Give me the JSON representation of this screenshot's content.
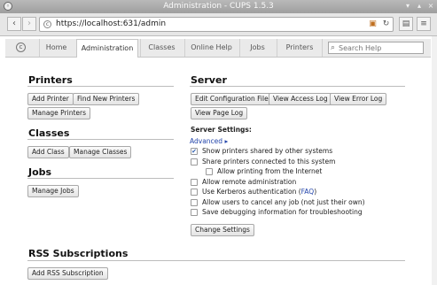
{
  "window": {
    "title": "Administration - CUPS 1.5.3"
  },
  "browser": {
    "url": "https://localhost:631/admin",
    "back_glyph": "‹",
    "forward_glyph": "›",
    "menu_glyph": "≡"
  },
  "tabs": [
    {
      "label": "Home",
      "active": false
    },
    {
      "label": "Administration",
      "active": true
    },
    {
      "label": "Classes",
      "active": false
    },
    {
      "label": "Online Help",
      "active": false
    },
    {
      "label": "Jobs",
      "active": false
    },
    {
      "label": "Printers",
      "active": false
    }
  ],
  "search": {
    "placeholder": "Search Help"
  },
  "printers": {
    "heading": "Printers",
    "buttons": [
      "Add Printer",
      "Find New Printers",
      "Manage Printers"
    ]
  },
  "classes": {
    "heading": "Classes",
    "buttons": [
      "Add Class",
      "Manage Classes"
    ]
  },
  "jobs": {
    "heading": "Jobs",
    "buttons": [
      "Manage Jobs"
    ]
  },
  "rss": {
    "heading": "RSS Subscriptions",
    "buttons": [
      "Add RSS Subscription"
    ]
  },
  "server": {
    "heading": "Server",
    "buttons": [
      "Edit Configuration File",
      "View Access Log",
      "View Error Log",
      "View Page Log"
    ],
    "settings_label": "Server Settings:",
    "advanced_link": "Advanced",
    "advanced_arrow": "▸",
    "options": [
      {
        "label": "Show printers shared by other systems",
        "checked": true
      },
      {
        "label": "Share printers connected to this system",
        "checked": false
      },
      {
        "label": "Allow printing from the Internet",
        "checked": false
      },
      {
        "label": "Allow remote administration",
        "checked": false
      },
      {
        "label": "Use Kerberos authentication (",
        "link": "FAQ",
        "suffix": ")",
        "checked": false
      },
      {
        "label": "Allow users to cancel any job (not just their own)",
        "checked": false
      },
      {
        "label": "Save debugging information for troubleshooting",
        "checked": false
      }
    ],
    "change_button": "Change Settings"
  }
}
